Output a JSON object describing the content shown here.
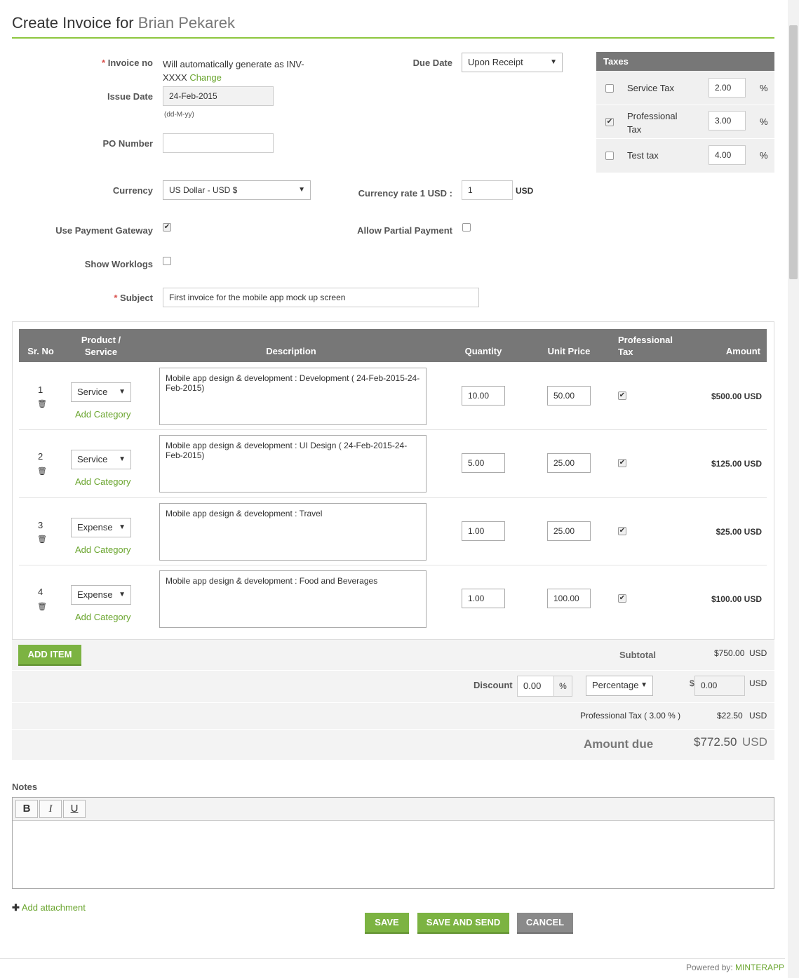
{
  "page": {
    "title_prefix": "Create Invoice for",
    "client_name": "Brian Pekarek"
  },
  "form": {
    "invoice_no_label": "Invoice no",
    "invoice_no_text_line1": "Will automatically generate as INV-",
    "invoice_no_text_line2": "XXXX",
    "change_link": "Change",
    "issue_date_label": "Issue Date",
    "issue_date_value": "24-Feb-2015",
    "date_hint": "(dd-M-yy)",
    "po_number_label": "PO Number",
    "po_number_value": "",
    "due_date_label": "Due Date",
    "due_date_value": "Upon Receipt",
    "currency_label": "Currency",
    "currency_value": "US Dollar - USD $",
    "currency_rate_label": "Currency rate 1 USD :",
    "currency_rate_value": "1",
    "currency_rate_unit": "USD",
    "payment_gateway_label": "Use Payment Gateway",
    "payment_gateway_checked": true,
    "partial_payment_label": "Allow Partial Payment",
    "partial_payment_checked": false,
    "show_worklogs_label": "Show Worklogs",
    "show_worklogs_checked": false,
    "subject_label": "Subject",
    "subject_value": "First invoice for the mobile app mock up screen",
    "required_mark": "*"
  },
  "taxes": {
    "header": "Taxes",
    "percent_sign": "%",
    "items": [
      {
        "name": "Service Tax",
        "value": "2.00",
        "checked": false
      },
      {
        "name_line1": "Professional",
        "name_line2": "Tax",
        "value": "3.00",
        "checked": true
      },
      {
        "name": "Test tax",
        "value": "4.00",
        "checked": false
      }
    ]
  },
  "table": {
    "headers": {
      "sr_no": "Sr. No",
      "product_line1": "Product /",
      "product_line2": "Service",
      "description": "Description",
      "quantity": "Quantity",
      "unit_price": "Unit Price",
      "tax_line1": "Professional",
      "tax_line2": "Tax",
      "amount": "Amount"
    },
    "add_category": "Add Category",
    "rows": [
      {
        "sr": "1",
        "type": "Service",
        "description": "Mobile app design & development : Development  ( 24-Feb-2015-24-Feb-2015)",
        "quantity": "10.00",
        "unit_price": "50.00",
        "taxed": true,
        "amount": "$500.00  USD"
      },
      {
        "sr": "2",
        "type": "Service",
        "description": "Mobile app design & development : UI Design  ( 24-Feb-2015-24-Feb-2015)",
        "quantity": "5.00",
        "unit_price": "25.00",
        "taxed": true,
        "amount": "$125.00  USD"
      },
      {
        "sr": "3",
        "type": "Expense",
        "description": "Mobile app design & development  : Travel",
        "quantity": "1.00",
        "unit_price": "25.00",
        "taxed": true,
        "amount": "$25.00  USD"
      },
      {
        "sr": "4",
        "type": "Expense",
        "description": "Mobile app design & development  : Food and Beverages",
        "quantity": "1.00",
        "unit_price": "100.00",
        "taxed": true,
        "amount": "$100.00  USD"
      }
    ]
  },
  "summary": {
    "add_item": "ADD ITEM",
    "subtotal_label": "Subtotal",
    "subtotal_value": "$750.00",
    "currency": "USD",
    "discount_label": "Discount",
    "discount_value": "0.00",
    "discount_unit": "%",
    "discount_type": "Percentage",
    "discount_symbol": "$",
    "discount_amount": "0.00",
    "tax_line_label": "Professional Tax ( 3.00 % )",
    "tax_line_value": "$22.50",
    "amount_due_label": "Amount due",
    "amount_due_value": "$772.50"
  },
  "notes": {
    "label": "Notes",
    "bold": "B",
    "italic": "I",
    "underline": "U",
    "value": ""
  },
  "actions": {
    "add_attachment": "Add attachment",
    "save": "SAVE",
    "save_and_send": "SAVE AND SEND",
    "cancel": "CANCEL"
  },
  "footer": {
    "powered_by": "Powered by:",
    "brand": "MINTERAPP"
  },
  "colors": {
    "accent_green": "#7cb342",
    "header_grey": "#777777",
    "required_red": "#d9534f"
  }
}
